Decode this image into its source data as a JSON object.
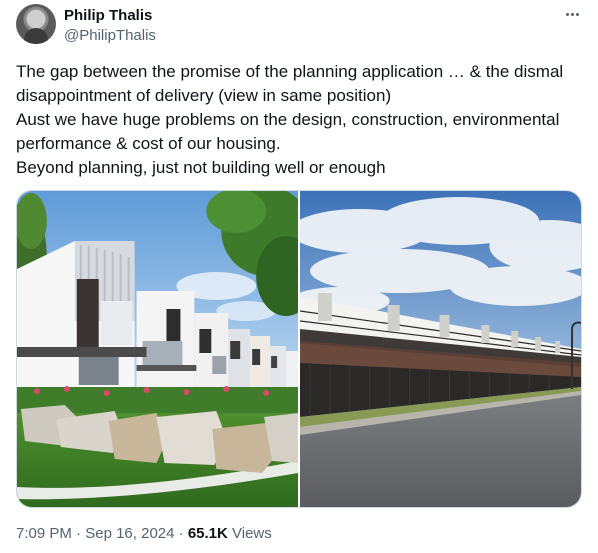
{
  "author": {
    "name": "Philip Thalis",
    "handle": "@PhilipThalis"
  },
  "post": {
    "lines": [
      "The gap between the promise of the planning application … & the dismal",
      "disappointment of delivery (view in same position)",
      "Aust we have huge problems on the design, construction, environmental",
      "performance & cost of our housing.",
      "Beyond planning, just not building well or enough"
    ]
  },
  "media": {
    "photos": [
      {
        "name": "planning-render-photo"
      },
      {
        "name": "delivered-townhouses-photo"
      }
    ]
  },
  "meta": {
    "time": "7:09 PM",
    "sep1": " · ",
    "date": "Sep 16, 2024",
    "sep2": " · ",
    "views_count": "65.1K",
    "views_label": " Views"
  },
  "icons": {
    "more": "more-horizontal-icon"
  },
  "colors": {
    "text_primary": "#0f1419",
    "text_secondary": "#536471",
    "border": "#cfd9de"
  }
}
